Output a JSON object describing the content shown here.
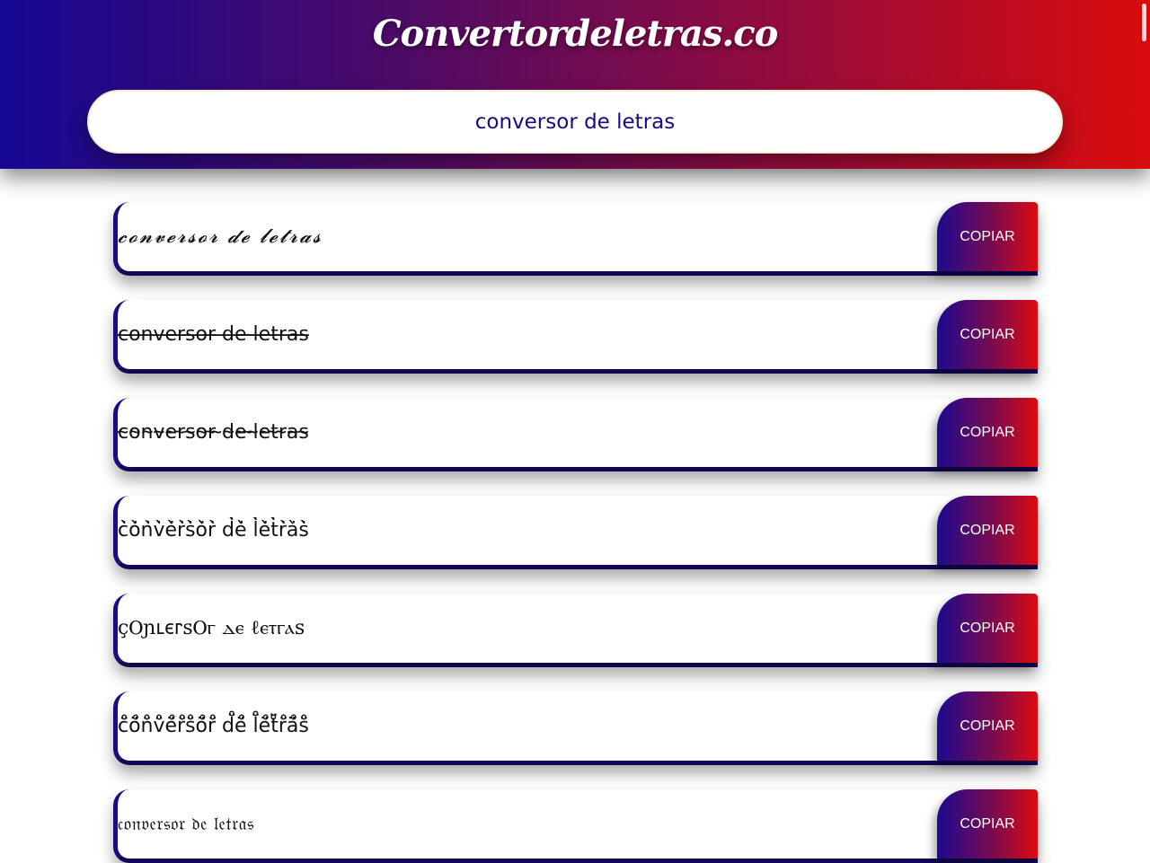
{
  "header": {
    "title": "Convertordeletras.co"
  },
  "search": {
    "value": "conversor de letras",
    "placeholder": ""
  },
  "results": [
    {
      "text": "𝓬𝓸𝓷𝓿𝓮𝓻𝓼𝓸𝓻 𝓭𝓮 𝓵𝓮𝓽𝓻𝓪𝓼",
      "copy_label": "COPIAR"
    },
    {
      "text": "c̶o̶n̶v̶e̶r̶s̶o̶r̶ ̶d̶e̶ ̶l̶e̶t̶r̶a̶s̶",
      "copy_label": "COPIAR"
    },
    {
      "text": "c̴o̴n̴v̴e̴r̴s̴o̴r̴ ̴d̴e̴ ̴l̴e̴t̴r̴a̴s̴",
      "copy_label": "COPIAR"
    },
    {
      "text": "c̀̇ò̇ǹ̇v̀̇è̇r̀̇s̀̇ò̇r̀̇ d̀̇è̇ l̀̇è̇t̀̇r̀̇à̇s̀̇",
      "copy_label": "COPIAR"
    },
    {
      "text": "çⲞɲⳑⲉⲅꜱⲞⲅ ⲇⲉ ℓⲉⲧⲅⲁꜱ",
      "copy_label": "COPIAR"
    },
    {
      "text": "c̈̊ö̊n̈̊v̈̊ë̊r̈̊s̈̊ö̊r̈̊ d̈̊ë̊ l̈̊ë̊ẗ̊r̈̊ä̊s̈̊",
      "copy_label": "COPIAR"
    },
    {
      "text": "𝔠𝔬𝔫𝔳𝔢𝔯𝔰𝔬𝔯 𝔡𝔢 𝔩𝔢𝔱𝔯𝔞𝔰",
      "copy_label": "COPIAR"
    }
  ]
}
